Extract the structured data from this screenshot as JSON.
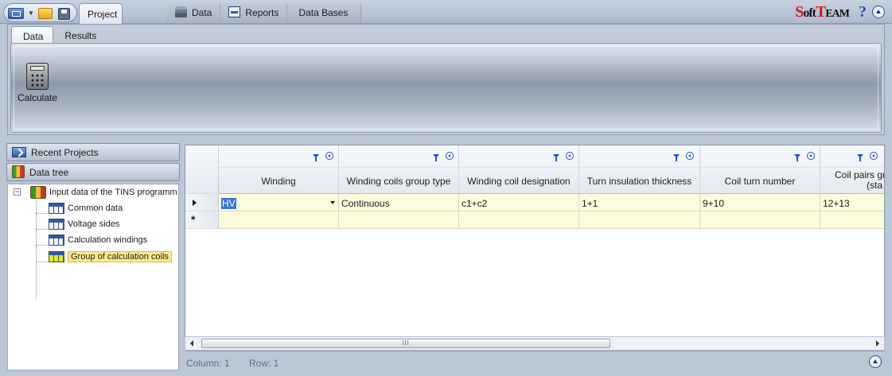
{
  "titlebar": {
    "project_tab": "Project",
    "context_tabs": [
      {
        "label": "Data",
        "icon": "database-icon"
      },
      {
        "label": "Reports",
        "icon": "report-icon"
      },
      {
        "label": "Data Bases",
        "icon": ""
      }
    ],
    "brand": {
      "s": "S",
      "oft": "oft",
      "t": "T",
      "eam": "EAM"
    },
    "help": "?"
  },
  "ribbon": {
    "tabs": [
      "Data",
      "Results"
    ],
    "active_tab": "Data",
    "buttons": [
      {
        "label": "Calculate",
        "icon": "calculator-icon"
      }
    ]
  },
  "nav": {
    "recent_projects": "Recent Projects",
    "data_tree": "Data tree",
    "tree": {
      "expander": "−",
      "root": "Input data of the TINS programm",
      "children": [
        {
          "label": "Common data"
        },
        {
          "label": "Voltage sides"
        },
        {
          "label": "Calculation windings"
        },
        {
          "label": "Group of calculation coils",
          "selected": true
        }
      ]
    }
  },
  "grid": {
    "columns": [
      "Winding",
      "Winding coils group type",
      "Winding coil designation",
      "Turn insulation thickness",
      "Coil turn number",
      "Coil pairs gra",
      "(sta"
    ],
    "rows": [
      [
        "HV",
        "Continuous",
        "c1+c2",
        "1+1",
        "9+10",
        "12+13"
      ]
    ],
    "new_row_marker": "*",
    "scroll_thumb": "III"
  },
  "status": {
    "column": "Column: 1",
    "row": "Row: 1"
  },
  "colors": {
    "cell_bg": "#fdfbdc",
    "selection": "#3875d7",
    "brand_red": "#d9141a"
  }
}
